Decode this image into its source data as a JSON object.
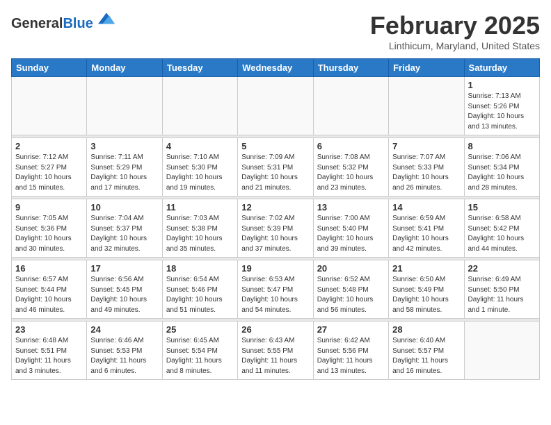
{
  "logo": {
    "general": "General",
    "blue": "Blue"
  },
  "header": {
    "month": "February 2025",
    "location": "Linthicum, Maryland, United States"
  },
  "weekdays": [
    "Sunday",
    "Monday",
    "Tuesday",
    "Wednesday",
    "Thursday",
    "Friday",
    "Saturday"
  ],
  "days": [
    {
      "date": "",
      "info": ""
    },
    {
      "date": "",
      "info": ""
    },
    {
      "date": "",
      "info": ""
    },
    {
      "date": "",
      "info": ""
    },
    {
      "date": "",
      "info": ""
    },
    {
      "date": "",
      "info": ""
    },
    {
      "date": "1",
      "info": "Sunrise: 7:13 AM\nSunset: 5:26 PM\nDaylight: 10 hours\nand 13 minutes."
    },
    {
      "date": "2",
      "info": "Sunrise: 7:12 AM\nSunset: 5:27 PM\nDaylight: 10 hours\nand 15 minutes."
    },
    {
      "date": "3",
      "info": "Sunrise: 7:11 AM\nSunset: 5:29 PM\nDaylight: 10 hours\nand 17 minutes."
    },
    {
      "date": "4",
      "info": "Sunrise: 7:10 AM\nSunset: 5:30 PM\nDaylight: 10 hours\nand 19 minutes."
    },
    {
      "date": "5",
      "info": "Sunrise: 7:09 AM\nSunset: 5:31 PM\nDaylight: 10 hours\nand 21 minutes."
    },
    {
      "date": "6",
      "info": "Sunrise: 7:08 AM\nSunset: 5:32 PM\nDaylight: 10 hours\nand 23 minutes."
    },
    {
      "date": "7",
      "info": "Sunrise: 7:07 AM\nSunset: 5:33 PM\nDaylight: 10 hours\nand 26 minutes."
    },
    {
      "date": "8",
      "info": "Sunrise: 7:06 AM\nSunset: 5:34 PM\nDaylight: 10 hours\nand 28 minutes."
    },
    {
      "date": "9",
      "info": "Sunrise: 7:05 AM\nSunset: 5:36 PM\nDaylight: 10 hours\nand 30 minutes."
    },
    {
      "date": "10",
      "info": "Sunrise: 7:04 AM\nSunset: 5:37 PM\nDaylight: 10 hours\nand 32 minutes."
    },
    {
      "date": "11",
      "info": "Sunrise: 7:03 AM\nSunset: 5:38 PM\nDaylight: 10 hours\nand 35 minutes."
    },
    {
      "date": "12",
      "info": "Sunrise: 7:02 AM\nSunset: 5:39 PM\nDaylight: 10 hours\nand 37 minutes."
    },
    {
      "date": "13",
      "info": "Sunrise: 7:00 AM\nSunset: 5:40 PM\nDaylight: 10 hours\nand 39 minutes."
    },
    {
      "date": "14",
      "info": "Sunrise: 6:59 AM\nSunset: 5:41 PM\nDaylight: 10 hours\nand 42 minutes."
    },
    {
      "date": "15",
      "info": "Sunrise: 6:58 AM\nSunset: 5:42 PM\nDaylight: 10 hours\nand 44 minutes."
    },
    {
      "date": "16",
      "info": "Sunrise: 6:57 AM\nSunset: 5:44 PM\nDaylight: 10 hours\nand 46 minutes."
    },
    {
      "date": "17",
      "info": "Sunrise: 6:56 AM\nSunset: 5:45 PM\nDaylight: 10 hours\nand 49 minutes."
    },
    {
      "date": "18",
      "info": "Sunrise: 6:54 AM\nSunset: 5:46 PM\nDaylight: 10 hours\nand 51 minutes."
    },
    {
      "date": "19",
      "info": "Sunrise: 6:53 AM\nSunset: 5:47 PM\nDaylight: 10 hours\nand 54 minutes."
    },
    {
      "date": "20",
      "info": "Sunrise: 6:52 AM\nSunset: 5:48 PM\nDaylight: 10 hours\nand 56 minutes."
    },
    {
      "date": "21",
      "info": "Sunrise: 6:50 AM\nSunset: 5:49 PM\nDaylight: 10 hours\nand 58 minutes."
    },
    {
      "date": "22",
      "info": "Sunrise: 6:49 AM\nSunset: 5:50 PM\nDaylight: 11 hours\nand 1 minute."
    },
    {
      "date": "23",
      "info": "Sunrise: 6:48 AM\nSunset: 5:51 PM\nDaylight: 11 hours\nand 3 minutes."
    },
    {
      "date": "24",
      "info": "Sunrise: 6:46 AM\nSunset: 5:53 PM\nDaylight: 11 hours\nand 6 minutes."
    },
    {
      "date": "25",
      "info": "Sunrise: 6:45 AM\nSunset: 5:54 PM\nDaylight: 11 hours\nand 8 minutes."
    },
    {
      "date": "26",
      "info": "Sunrise: 6:43 AM\nSunset: 5:55 PM\nDaylight: 11 hours\nand 11 minutes."
    },
    {
      "date": "27",
      "info": "Sunrise: 6:42 AM\nSunset: 5:56 PM\nDaylight: 11 hours\nand 13 minutes."
    },
    {
      "date": "28",
      "info": "Sunrise: 6:40 AM\nSunset: 5:57 PM\nDaylight: 11 hours\nand 16 minutes."
    },
    {
      "date": "",
      "info": ""
    }
  ]
}
